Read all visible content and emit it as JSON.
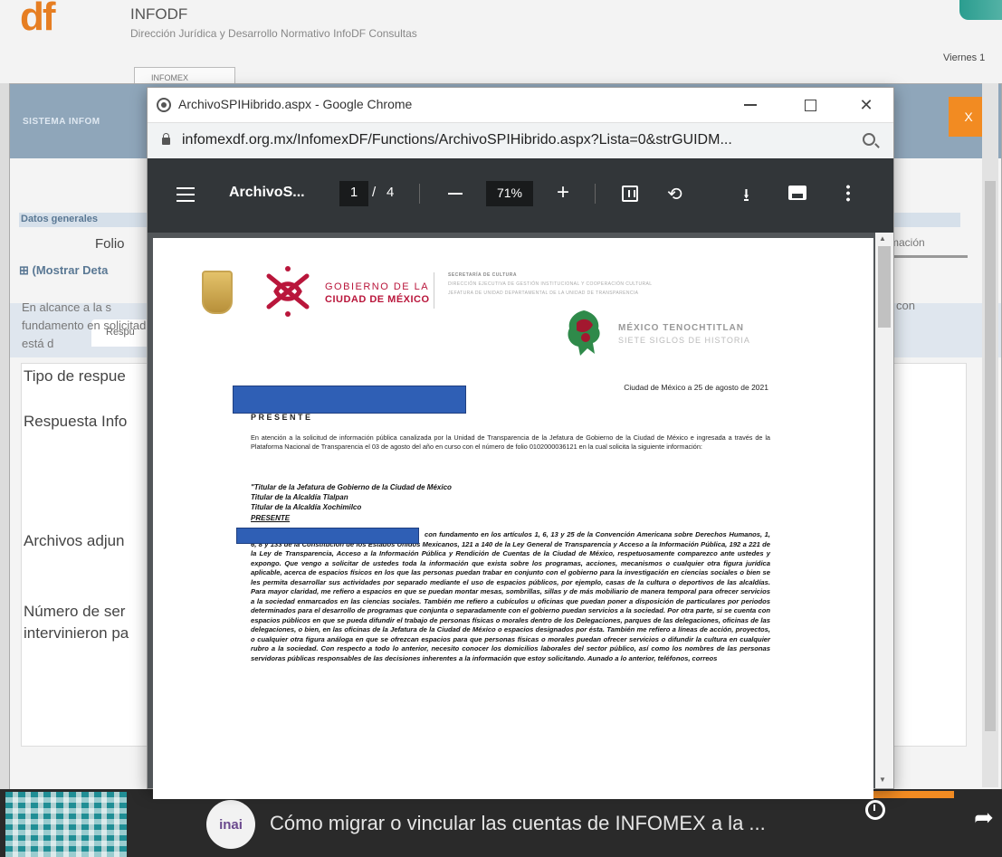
{
  "background_site": {
    "logo_text": "df",
    "site_title": "INFODF",
    "site_subtitle": "Dirección Jurídica y Desarrollo Normativo InfoDF Consultas",
    "date_text": "Viernes 1",
    "nav_tab_label": "INFOMEX",
    "modal_bar_text": "SISTEMA INFOM",
    "modal_close_label": "X",
    "section_title": "Datos generales",
    "folio_label": "Folio",
    "show_details_label": "⊞ (Mostrar Deta",
    "info_tab_label": "rmación",
    "response_tab_label": "Respu",
    "alcance_text": "En alcance a la s fundamento en solicitada está d",
    "con_text": "con",
    "tipo_label": "Tipo de respue",
    "respuesta_label": "Respuesta Info",
    "archivos_label": "Archivos adjun",
    "numero_label": "Número de ser intervinieron pa"
  },
  "video_overlay": {
    "channel_logo_text": "inai",
    "title": "Cómo migrar o vincular las cuentas de INFOMEX a la ...",
    "watch_later_label": "Ver más tarde",
    "share_label": "Compartir"
  },
  "chrome_window": {
    "title": "ArchivoSPIHibrido.aspx - Google Chrome",
    "url": "infomexdf.org.mx/InfomexDF/Functions/ArchivoSPIHibrido.aspx?Lista=0&strGUIDM...",
    "minimize_icon": "minimize-icon",
    "maximize_icon": "maximize-icon",
    "close_label": "✕"
  },
  "pdf_viewer": {
    "doc_title": "ArchivoS...",
    "current_page": "1",
    "page_separator": "/",
    "total_pages": "4",
    "zoom_out_label": "—",
    "zoom": "71%",
    "zoom_in_label": "+",
    "rotate_label": "⟲",
    "download_label": "⭳"
  },
  "pdf_page": {
    "gov_line_1": "GOBIERNO DE LA",
    "gov_line_2": "CIUDAD DE MÉXICO",
    "dependency_1": "SECRETARÍA DE CULTURA",
    "dependency_2": "DIRECCIÓN EJECUTIVA DE GESTIÓN INSTITUCIONAL Y COOPERACIÓN CULTURAL",
    "dependency_3": "JEFATURA DE UNIDAD DEPARTAMENTAL DE LA UNIDAD DE TRANSPARENCIA",
    "tenoch_1": "MÉXICO TENOCHTITLAN",
    "tenoch_2": "SIETE SIGLOS DE HISTORIA",
    "date_line": "Ciudad de México a 25 de agosto de 2021",
    "presente": "PRESENTE",
    "intro_paragraph": "En atención a la solicitud de información pública canalizada por la Unidad de Transparencia de la Jefatura de Gobierno de la Ciudad de México e ingresada a través de la Plataforma Nacional de Transparencia el 03 de agosto del año en curso con el número de folio 0102000036121 en la cual solicita la siguiente información:",
    "quote_line_1": "\"Titular de la Jefatura de Gobierno de la Ciudad de México",
    "quote_line_2": "Titular de la Alcaldía Tlalpan",
    "quote_line_3": "Titular de la Alcaldía Xochimilco",
    "quote_line_4": "PRESENTE",
    "body_paragraph": "con fundamento en los artículos 1, 6, 13 y 25 de la Convención Americana sobre Derechos Humanos, 1, 6, 8 y 133 de la Constitución de los Estados Unidos Mexicanos, 121 a 140 de la Ley General de Transparencia y Acceso a la Información Pública, 192 a 221 de la Ley de Transparencia, Acceso a la Información Pública y Rendición de Cuentas de la Ciudad de México, respetuosamente comparezco ante ustedes y expongo. Que vengo a solicitar de ustedes toda la información que exista sobre los programas, acciones, mecanismos o cualquier otra figura jurídica aplicable, acerca de espacios físicos en los que las personas puedan trabar en conjunto con el gobierno para la investigación en ciencias sociales o bien se les permita desarrollar sus actividades por separado mediante el uso de espacios públicos, por ejemplo, casas de la cultura o deportivos de las alcaldías. Para mayor claridad, me refiero a espacios en que se puedan montar mesas, sombrillas, sillas y de más mobiliario de manera temporal para ofrecer servicios a la sociedad enmarcados en las ciencias sociales. También me refiero a cubículos u oficinas que puedan poner a disposición de particulares por periodos determinados para el desarrollo de programas que conjunta o separadamente con el gobierno puedan servicios a la sociedad. Por otra parte, si se cuenta con espacios públicos en que se pueda difundir el trabajo de personas físicas o morales dentro de los Delegaciones, parques de las delegaciones, oficinas de las delegaciones, o bien, en las oficinas de la Jefatura de la Ciudad de México o espacios designados por ésta. También me refiero a líneas de acción, proyectos, o cualquier otra figura análoga en que se ofrezcan espacios para que personas físicas o morales puedan ofrecer servicios o difundir la cultura en cualquier rubro a la sociedad. Con respecto a todo lo anterior, necesito conocer los domicilios laborales del sector público, así como los nombres de las personas servidoras públicas responsables de las decisiones inherentes a la información que estoy solicitando. Aunado a lo anterior, teléfonos, correos"
  },
  "colors": {
    "gov_red": "#b9163b",
    "pdf_toolbar": "#323639",
    "redaction_blue": "#2f5fb5",
    "close_orange": "#f28b22"
  }
}
